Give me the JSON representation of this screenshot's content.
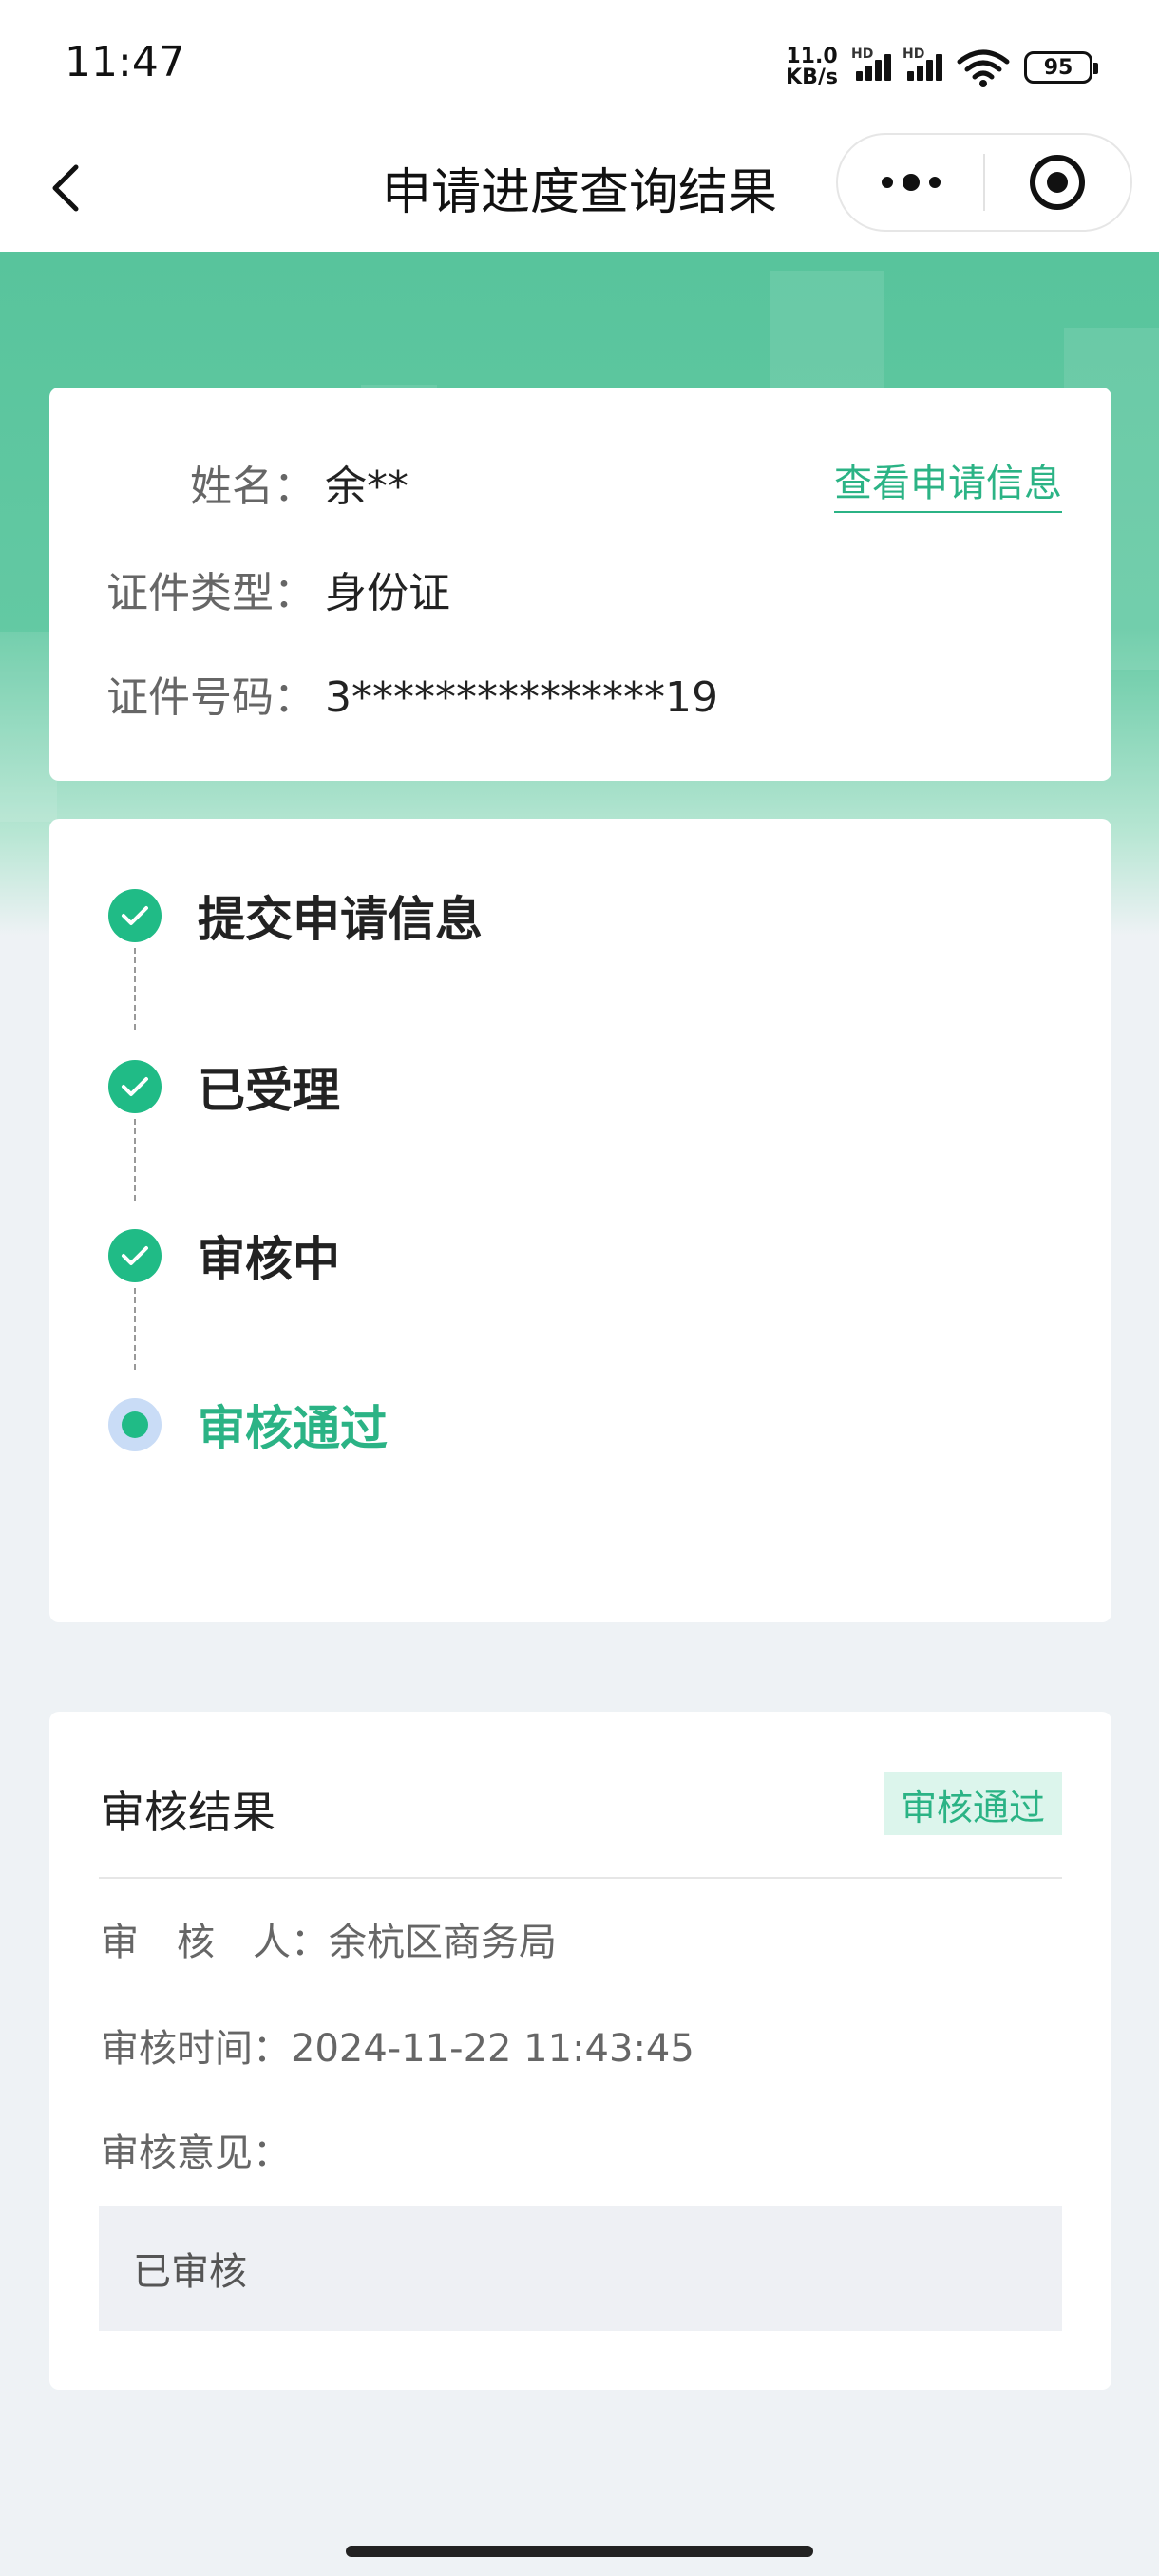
{
  "status_bar": {
    "time": "11:47",
    "net_speed_value": "11.0",
    "net_speed_unit": "KB/s",
    "sim1_label": "HD",
    "sim2_label": "HD",
    "battery": "95"
  },
  "nav": {
    "title": "申请进度查询结果"
  },
  "applicant": {
    "name_label": "姓名：",
    "name_value": "余**",
    "id_type_label": "证件类型：",
    "id_type_value": "身份证",
    "id_number_label": "证件号码：",
    "id_number_value": "3***************19",
    "view_info_link": "查看申请信息"
  },
  "progress": {
    "steps": [
      {
        "label": "提交申请信息",
        "status": "done"
      },
      {
        "label": "已受理",
        "status": "done"
      },
      {
        "label": "审核中",
        "status": "done"
      },
      {
        "label": "审核通过",
        "status": "current"
      }
    ]
  },
  "result": {
    "title": "审核结果",
    "badge": "审核通过",
    "reviewer_label": "审　核　人：",
    "reviewer_value": "余杭区商务局",
    "time_label": "审核时间：",
    "time_value": "2024-11-22 11:43:45",
    "opinion_label": "审核意见：",
    "opinion_value": "已审核"
  },
  "colors": {
    "accent": "#20bb86",
    "link": "#2bb385",
    "current_ring": "#c9dcf6"
  }
}
